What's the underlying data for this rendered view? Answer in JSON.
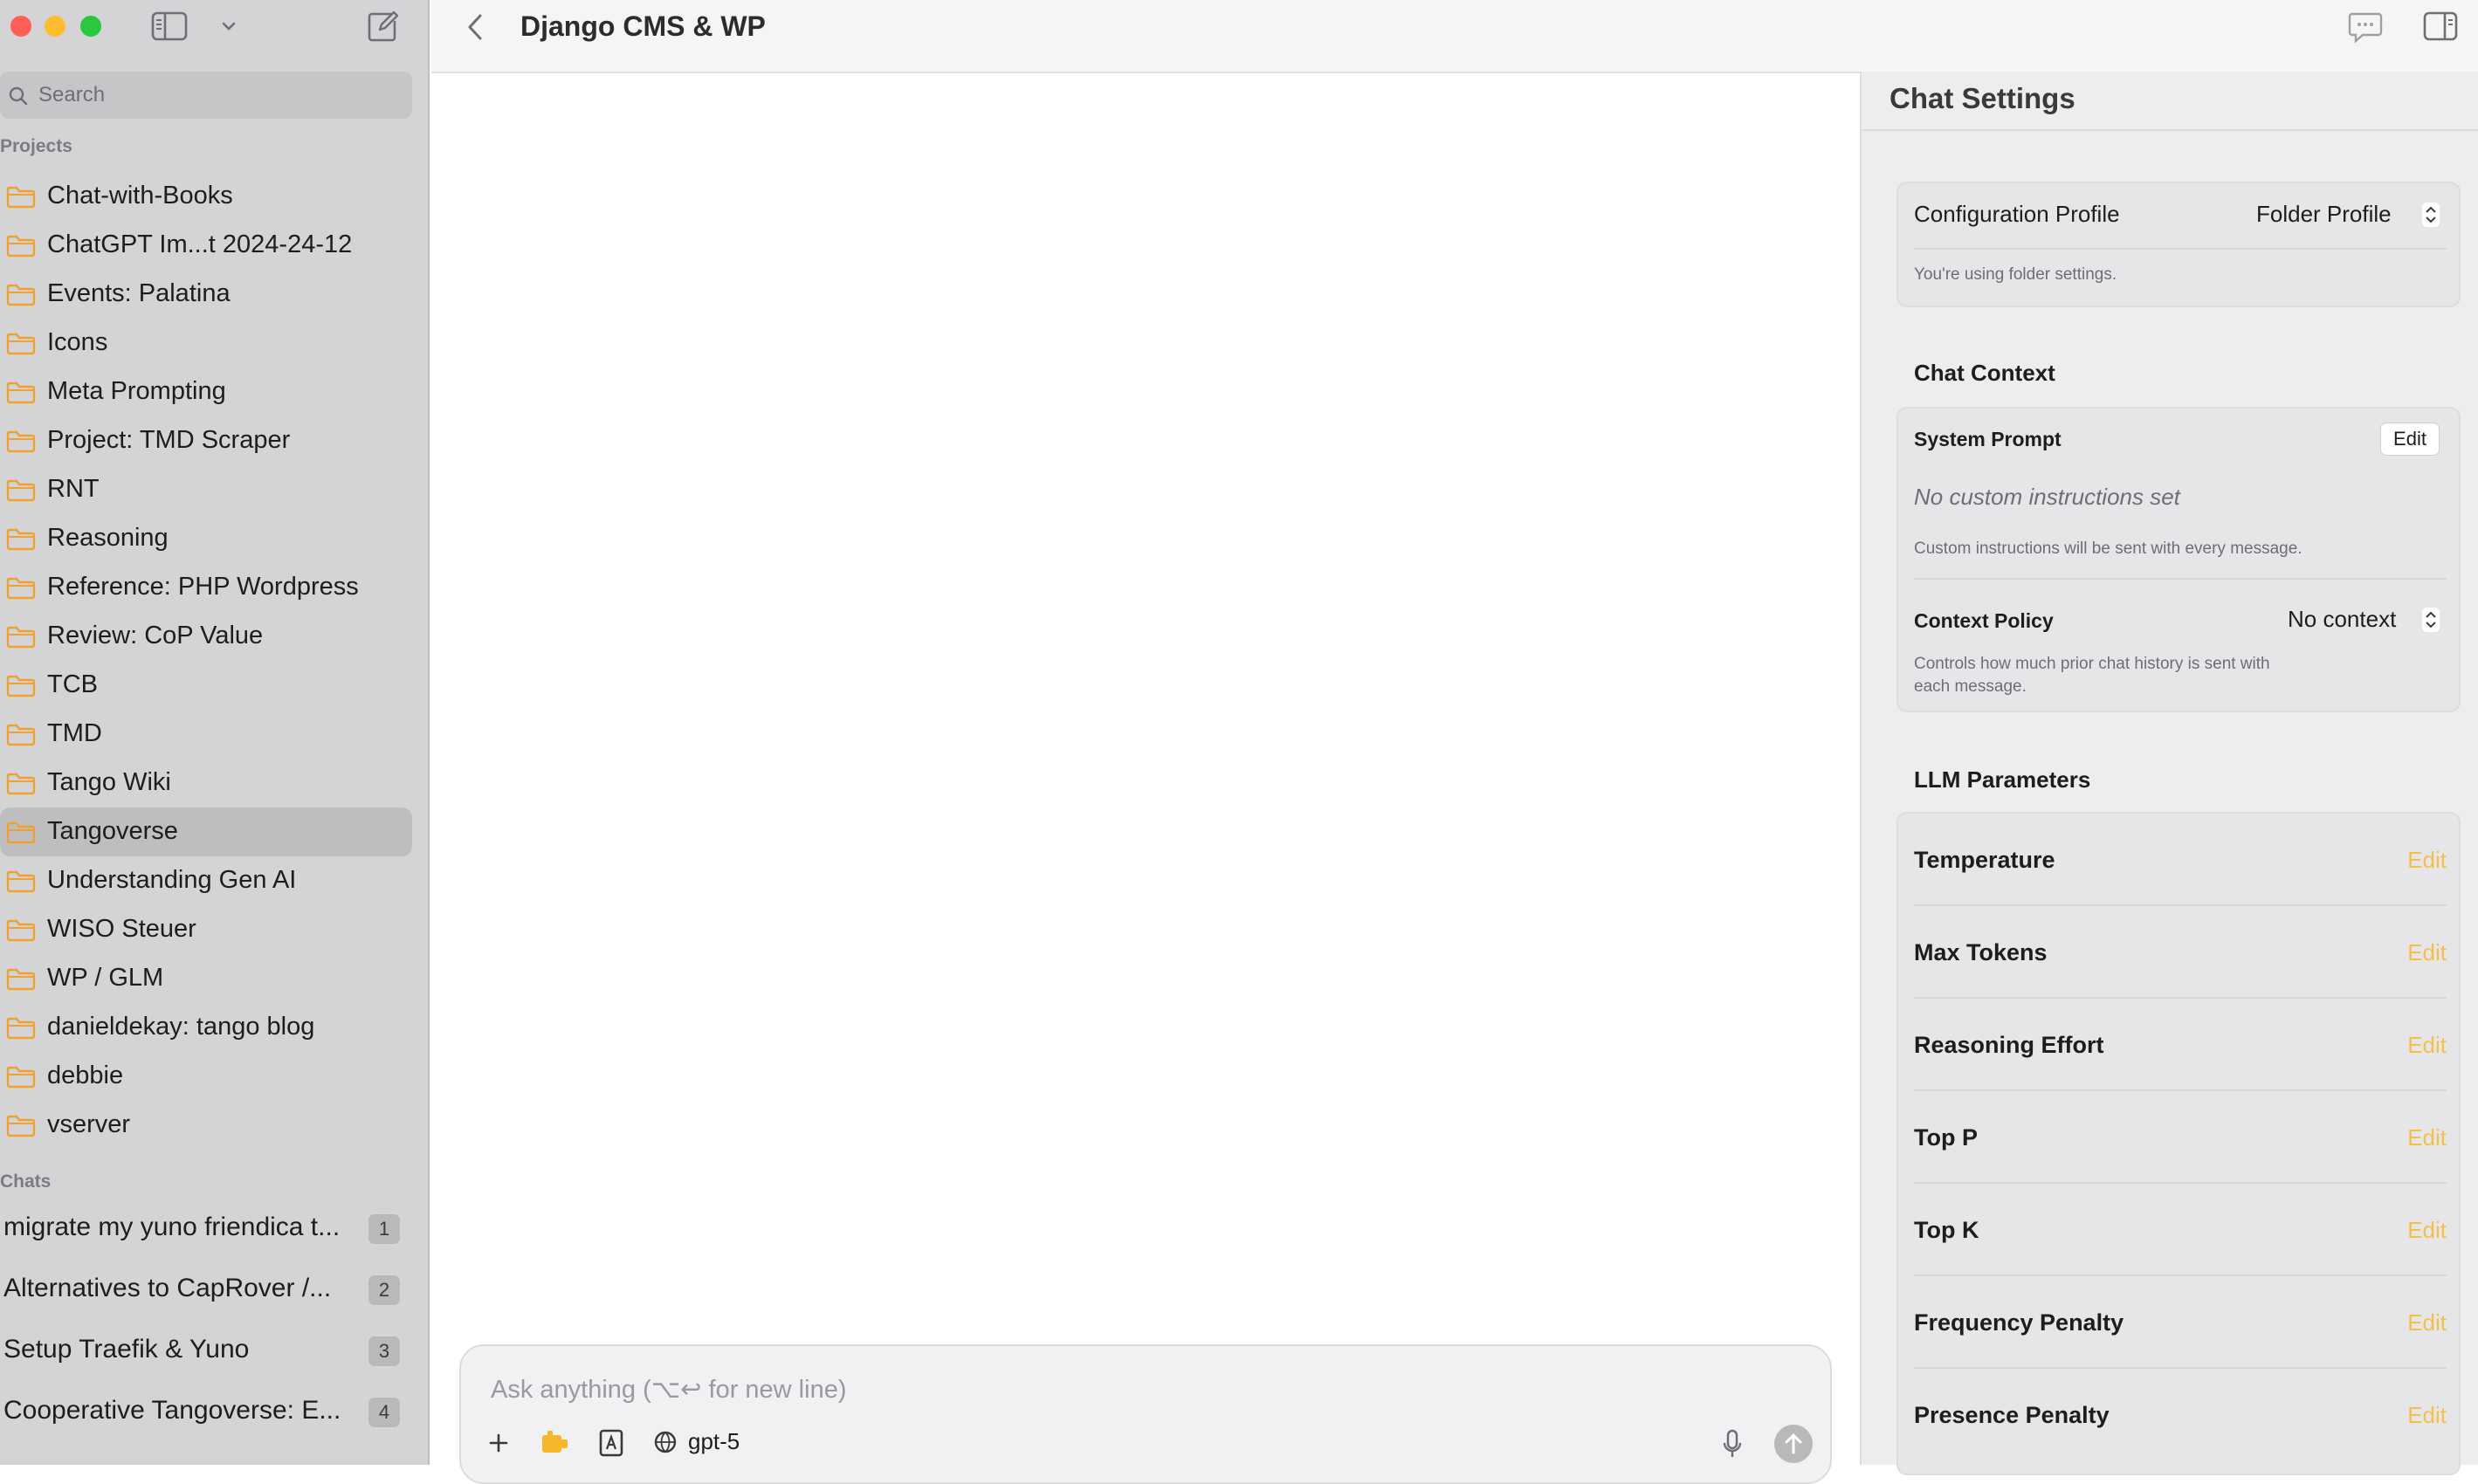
{
  "sidebar": {
    "search_placeholder": "Search",
    "projects_label": "Projects",
    "chats_label": "Chats",
    "projects": [
      {
        "label": "Chat-with-Books"
      },
      {
        "label": "ChatGPT Im...t 2024-24-12"
      },
      {
        "label": "Events: Palatina"
      },
      {
        "label": "Icons"
      },
      {
        "label": "Meta Prompting"
      },
      {
        "label": "Project: TMD Scraper"
      },
      {
        "label": "RNT"
      },
      {
        "label": "Reasoning"
      },
      {
        "label": "Reference: PHP Wordpress"
      },
      {
        "label": "Review: CoP Value"
      },
      {
        "label": "TCB"
      },
      {
        "label": "TMD"
      },
      {
        "label": "Tango Wiki"
      },
      {
        "label": "Tangoverse",
        "selected": true
      },
      {
        "label": "Understanding Gen AI"
      },
      {
        "label": "WISO Steuer"
      },
      {
        "label": "WP / GLM"
      },
      {
        "label": "danieldekay: tango blog"
      },
      {
        "label": "debbie"
      },
      {
        "label": "vserver"
      }
    ],
    "chats": [
      {
        "label": "migrate my yuno friendica t...",
        "badge": "1"
      },
      {
        "label": "Alternatives to CapRover /...",
        "badge": "2"
      },
      {
        "label": "Setup Traefik & Yuno",
        "badge": "3"
      },
      {
        "label": "Cooperative Tangoverse: E...",
        "badge": "4"
      }
    ]
  },
  "topbar": {
    "title": "Django CMS & WP"
  },
  "composer": {
    "placeholder": "Ask anything (⌥↩ for new line)",
    "model": "gpt-5"
  },
  "settings": {
    "title": "Chat Settings",
    "config_profile_label": "Configuration Profile",
    "config_profile_value": "Folder Profile",
    "config_profile_note": "You're using folder settings.",
    "chat_context_heading": "Chat Context",
    "system_prompt_label": "System Prompt",
    "system_prompt_edit": "Edit",
    "system_prompt_value": "No custom instructions set",
    "system_prompt_note": "Custom instructions will be sent with every message.",
    "context_policy_label": "Context Policy",
    "context_policy_value": "No context",
    "context_policy_note_1": "Controls how much prior chat history is sent with",
    "context_policy_note_2": "each message.",
    "llm_heading": "LLM Parameters",
    "params": [
      {
        "name": "Temperature",
        "edit": "Edit"
      },
      {
        "name": "Max Tokens",
        "edit": "Edit"
      },
      {
        "name": "Reasoning Effort",
        "edit": "Edit"
      },
      {
        "name": "Top P",
        "edit": "Edit"
      },
      {
        "name": "Top K",
        "edit": "Edit"
      },
      {
        "name": "Frequency Penalty",
        "edit": "Edit"
      },
      {
        "name": "Presence Penalty",
        "edit": "Edit"
      }
    ]
  },
  "colors": {
    "accent_edit": "#f4c04b",
    "folder_icon": "#f0a030",
    "sidebar_bg": "#d4d4d6"
  }
}
